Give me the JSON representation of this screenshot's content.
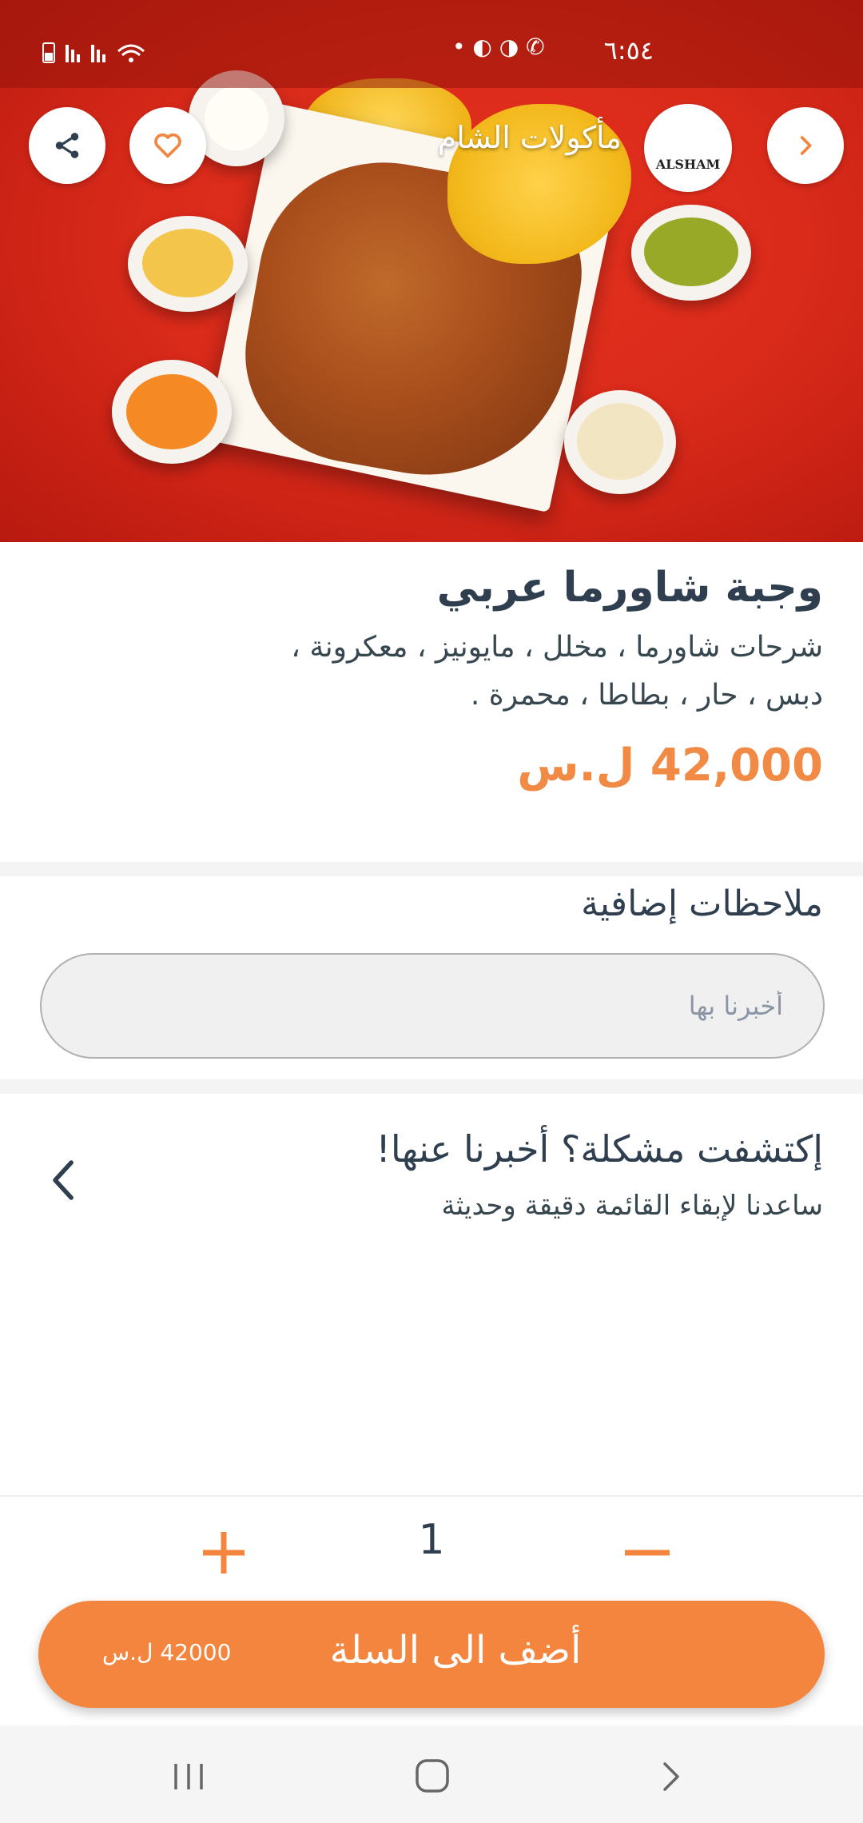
{
  "status_bar": {
    "time": "٦:٥٤"
  },
  "header": {
    "restaurant_name": "مأكولات الشام",
    "logo_text": "ALSHAM",
    "icons": {
      "share": "share-icon",
      "favorite": "heart-icon",
      "forward": "chevron-right-icon"
    }
  },
  "product": {
    "title": "وجبة شاورما عربي",
    "description": "شرحات شاورما ، مخلل ، مايونيز ، معكرونة ، دبس ، حار ، بطاطا ، محمرة .",
    "price_value": "42,000",
    "price_currency": "ل.س"
  },
  "notes": {
    "title": "ملاحظات إضافية",
    "placeholder": "أخبرنا بها",
    "value": ""
  },
  "report": {
    "title": "إكتشفت مشكلة؟ أخبرنا عنها!",
    "subtitle": "ساعدنا لإبقاء القائمة دقيقة وحديثة"
  },
  "cart": {
    "quantity": "1",
    "add_label": "أضف الى السلة",
    "total_price": "42000 ل.س"
  },
  "colors": {
    "accent": "#f4853f",
    "text_dark": "#2f3f4f",
    "hero_red": "#d92a1a"
  }
}
